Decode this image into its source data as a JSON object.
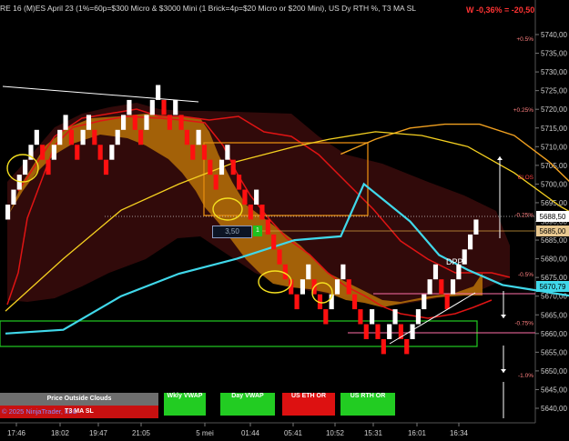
{
  "header": {
    "title": "RE 16 (M)ES April 23 (1%=60p=$300 Micro & $3000 Mini  (1 Brick=4p=$20 Micro or $200 Mini), US Dy RTH %, T3 MA SL",
    "pnl": "W -0,36% = -20,50"
  },
  "panel_buttons": [
    {
      "label": "Price Outside Clouds",
      "color": "#6e6e6e"
    },
    {
      "label": "Wkly VWAP",
      "color": "#22cc22"
    },
    {
      "label": "Day VWAP",
      "color": "#22cc22"
    },
    {
      "label": "US ETH OR",
      "color": "#dd1111"
    },
    {
      "label": "US RTH OR",
      "color": "#22cc22"
    }
  ],
  "sub_label": "T3 MA SL",
  "copyright": "© 2025 NinjaTrader, LLC",
  "order_entry": {
    "value": "3,50",
    "button": "1"
  },
  "annotation": "DPP",
  "chart_data": {
    "type": "renko",
    "ylim": [
      5636,
      5745
    ],
    "y_ticks": [
      5640,
      5645,
      5650,
      5655,
      5660,
      5665,
      5670,
      5675,
      5680,
      5685,
      5690,
      5695,
      5700,
      5705,
      5710,
      5715,
      5720,
      5725,
      5730,
      5735,
      5740
    ],
    "x_ticks": [
      "17:46",
      "18:02",
      "19:47",
      "21:05",
      "5 mei",
      "01:44",
      "05:41",
      "10:52",
      "15:31",
      "16:01",
      "16:34"
    ],
    "price_badges": [
      {
        "value": "5688,50",
        "kind": "last"
      },
      {
        "value": "5685,00",
        "kind": "level"
      },
      {
        "value": "5670,79",
        "kind": "ma"
      }
    ],
    "percent_levels": [
      {
        "label": "+0.5%",
        "price": 5739
      },
      {
        "label": "+0.25%",
        "price": 5720
      },
      {
        "label": "Cl.OS",
        "price": 5702
      },
      {
        "label": "-0.25%",
        "price": 5692
      },
      {
        "label": "-0.5%",
        "price": 5676
      },
      {
        "label": "-0.75%",
        "price": 5663
      },
      {
        "label": "-1.0%",
        "price": 5649
      }
    ],
    "bricks": [
      {
        "c": "w",
        "lo": 5690.5
      },
      {
        "c": "w",
        "lo": 5694.5
      },
      {
        "c": "w",
        "lo": 5698.5
      },
      {
        "c": "w",
        "lo": 5702.5
      },
      {
        "c": "w",
        "lo": 5706.5
      },
      {
        "c": "w",
        "lo": 5710.5
      },
      {
        "c": "r",
        "lo": 5706.5
      },
      {
        "c": "r",
        "lo": 5702.5
      },
      {
        "c": "w",
        "lo": 5706.5
      },
      {
        "c": "w",
        "lo": 5710.5
      },
      {
        "c": "w",
        "lo": 5714.5
      },
      {
        "c": "r",
        "lo": 5710.5
      },
      {
        "c": "r",
        "lo": 5706.5
      },
      {
        "c": "w",
        "lo": 5710.5
      },
      {
        "c": "w",
        "lo": 5714.5
      },
      {
        "c": "r",
        "lo": 5710.5
      },
      {
        "c": "r",
        "lo": 5706.5
      },
      {
        "c": "r",
        "lo": 5702.5
      },
      {
        "c": "w",
        "lo": 5706.5
      },
      {
        "c": "w",
        "lo": 5710.5
      },
      {
        "c": "w",
        "lo": 5714.5
      },
      {
        "c": "w",
        "lo": 5718.5
      },
      {
        "c": "r",
        "lo": 5714.5
      },
      {
        "c": "r",
        "lo": 5710.5
      },
      {
        "c": "w",
        "lo": 5714.5
      },
      {
        "c": "w",
        "lo": 5718.5
      },
      {
        "c": "w",
        "lo": 5722.5
      },
      {
        "c": "r",
        "lo": 5718.5
      },
      {
        "c": "r",
        "lo": 5714.5
      },
      {
        "c": "w",
        "lo": 5718.5
      },
      {
        "c": "r",
        "lo": 5714.5
      },
      {
        "c": "r",
        "lo": 5710.5
      },
      {
        "c": "r",
        "lo": 5706.5
      },
      {
        "c": "w",
        "lo": 5710.5
      },
      {
        "c": "r",
        "lo": 5706.5
      },
      {
        "c": "r",
        "lo": 5702.5
      },
      {
        "c": "r",
        "lo": 5698.5
      },
      {
        "c": "w",
        "lo": 5702.5
      },
      {
        "c": "w",
        "lo": 5706.5
      },
      {
        "c": "r",
        "lo": 5702.5
      },
      {
        "c": "r",
        "lo": 5698.5
      },
      {
        "c": "r",
        "lo": 5694.5
      },
      {
        "c": "r",
        "lo": 5690.5
      },
      {
        "c": "w",
        "lo": 5694.5
      },
      {
        "c": "r",
        "lo": 5690.5
      },
      {
        "c": "r",
        "lo": 5686.5
      },
      {
        "c": "r",
        "lo": 5682.5
      },
      {
        "c": "r",
        "lo": 5678.5
      },
      {
        "c": "r",
        "lo": 5674.5
      },
      {
        "c": "r",
        "lo": 5670.5
      },
      {
        "c": "r",
        "lo": 5666.5
      },
      {
        "c": "w",
        "lo": 5670.5
      },
      {
        "c": "w",
        "lo": 5674.5
      },
      {
        "c": "r",
        "lo": 5670.5
      },
      {
        "c": "r",
        "lo": 5666.5
      },
      {
        "c": "r",
        "lo": 5662.5
      },
      {
        "c": "w",
        "lo": 5666.5
      },
      {
        "c": "w",
        "lo": 5670.5
      },
      {
        "c": "w",
        "lo": 5674.5
      },
      {
        "c": "r",
        "lo": 5670.5
      },
      {
        "c": "r",
        "lo": 5666.5
      },
      {
        "c": "r",
        "lo": 5662.5
      },
      {
        "c": "r",
        "lo": 5658.5
      },
      {
        "c": "w",
        "lo": 5662.5
      },
      {
        "c": "r",
        "lo": 5658.5
      },
      {
        "c": "r",
        "lo": 5654.5
      },
      {
        "c": "w",
        "lo": 5658.5
      },
      {
        "c": "w",
        "lo": 5662.5
      },
      {
        "c": "r",
        "lo": 5658.5
      },
      {
        "c": "r",
        "lo": 5654.5
      },
      {
        "c": "w",
        "lo": 5658.5
      },
      {
        "c": "w",
        "lo": 5662.5
      },
      {
        "c": "w",
        "lo": 5666.5
      },
      {
        "c": "w",
        "lo": 5670.5
      },
      {
        "c": "w",
        "lo": 5674.5
      },
      {
        "c": "r",
        "lo": 5670.5
      },
      {
        "c": "r",
        "lo": 5666.5
      },
      {
        "c": "w",
        "lo": 5670.5
      },
      {
        "c": "w",
        "lo": 5674.5
      },
      {
        "c": "w",
        "lo": 5678.5
      },
      {
        "c": "w",
        "lo": 5682.5
      },
      {
        "c": "w",
        "lo": 5686.5
      }
    ],
    "ma_cyan": [
      [
        0,
        5660
      ],
      [
        10,
        5661
      ],
      [
        20,
        5670
      ],
      [
        30,
        5676
      ],
      [
        40,
        5680
      ],
      [
        50,
        5685
      ],
      [
        58,
        5686
      ],
      [
        62,
        5700
      ],
      [
        66,
        5695
      ],
      [
        70,
        5690
      ],
      [
        75,
        5681
      ],
      [
        80,
        5677
      ],
      [
        86,
        5673
      ],
      [
        90,
        5672
      ],
      [
        98,
        5670
      ],
      [
        104,
        5671
      ],
      [
        112,
        5673
      ],
      [
        118,
        5673
      ],
      [
        124,
        5673
      ],
      [
        130,
        5674
      ],
      [
        136,
        5677
      ],
      [
        140,
        5679
      ]
    ],
    "ma_yellow": [
      [
        0,
        5666
      ],
      [
        10,
        5680
      ],
      [
        20,
        5693
      ],
      [
        30,
        5700
      ],
      [
        40,
        5706
      ],
      [
        50,
        5710
      ],
      [
        56,
        5712
      ],
      [
        64,
        5714
      ],
      [
        72,
        5713
      ],
      [
        80,
        5710
      ],
      [
        88,
        5703
      ],
      [
        96,
        5694
      ],
      [
        104,
        5687
      ],
      [
        112,
        5680
      ],
      [
        120,
        5676
      ],
      [
        126,
        5673
      ],
      [
        130,
        5672
      ]
    ],
    "ma_orange": [
      [
        58,
        5708
      ],
      [
        64,
        5712
      ],
      [
        70,
        5715
      ],
      [
        76,
        5716
      ],
      [
        82,
        5716
      ],
      [
        88,
        5713
      ],
      [
        94,
        5706
      ],
      [
        100,
        5697
      ],
      [
        106,
        5686
      ],
      [
        112,
        5678
      ],
      [
        118,
        5674
      ],
      [
        124,
        5674
      ]
    ]
  }
}
